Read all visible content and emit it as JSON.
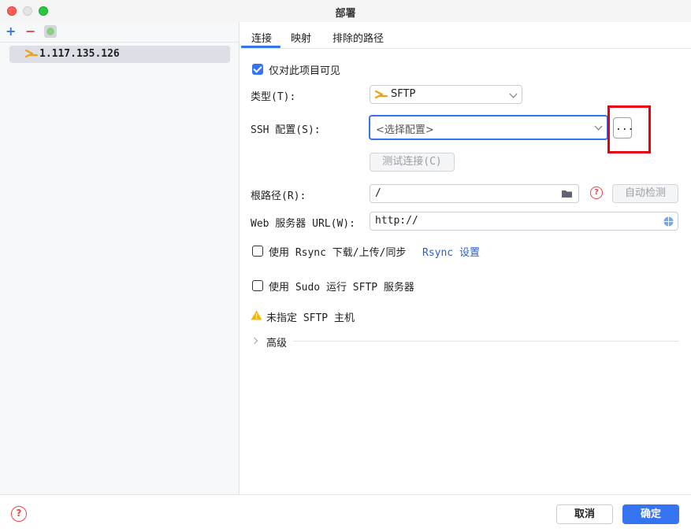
{
  "window": {
    "title": "部署"
  },
  "left_panel": {
    "toolbar": {
      "add": "+",
      "remove": "−"
    },
    "servers": [
      {
        "label": "1.117.135.126"
      }
    ]
  },
  "tabs": [
    {
      "label": "连接"
    },
    {
      "label": "映射"
    },
    {
      "label": "排除的路径"
    }
  ],
  "connection": {
    "visible_only_label": "仅对此项目可见",
    "visible_only_checked": true,
    "type_label": "类型(T):",
    "type_value": "SFTP",
    "ssh_label": "SSH 配置(S):",
    "ssh_placeholder": "<选择配置>",
    "ssh_more": "...",
    "test_button": "测试连接(C)",
    "root_label": "根路径(R):",
    "root_value": "/",
    "autodetect_button": "自动检测",
    "web_label": "Web 服务器 URL(W):",
    "web_value": "http://",
    "rsync_label": "使用 Rsync 下载/上传/同步",
    "rsync_checked": false,
    "rsync_link": "Rsync 设置",
    "sudo_label": "使用 Sudo 运行 SFTP 服务器",
    "sudo_checked": false,
    "warning": "未指定 SFTP 主机",
    "advanced_label": "高级"
  },
  "footer": {
    "help": "?",
    "cancel": "取消",
    "ok": "确定"
  },
  "colors": {
    "accent": "#3574f0",
    "danger": "#e5484d",
    "warning": "#f2b705",
    "highlight": "#e60012"
  }
}
